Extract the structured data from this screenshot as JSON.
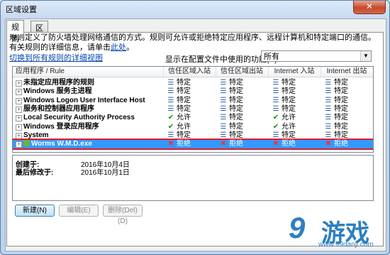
{
  "window": {
    "title": "区域设置",
    "close_label": "✕"
  },
  "tabs": [
    {
      "label": "规则"
    },
    {
      "label": "区域"
    }
  ],
  "description": {
    "text": "规则定义了防火墙处理网络通信的方式。规则可允许或拒绝特定应用程序、远程计算机和特定端口的通信。 有关规则的详细信息，请单击",
    "link": "此处",
    "end": "。"
  },
  "switch_link": "切换到所有规则的详细视图",
  "show_label": "显示在配置文件中使用的功能(P):",
  "show_select": {
    "value": "所有"
  },
  "columns": {
    "rule": "应用程序 / Rule",
    "trusted_in": "信任区域入站",
    "trusted_out": "信任区域出站",
    "internet_in": "Internet 入站",
    "internet_out": "Internet 出站"
  },
  "rows": [
    {
      "name": "未指定应用程序的规则",
      "trusted_in": "特定",
      "trusted_out": "特定",
      "internet_in": "特定",
      "internet_out": "特定",
      "icons": [
        "spec",
        "spec",
        "spec",
        "spec"
      ]
    },
    {
      "name": "Windows 服务主进程",
      "trusted_in": "特定",
      "trusted_out": "特定",
      "internet_in": "特定",
      "internet_out": "特定",
      "icons": [
        "spec",
        "spec",
        "spec",
        "spec"
      ]
    },
    {
      "name": "Windows Logon User Interface Host",
      "trusted_in": "特定",
      "trusted_out": "特定",
      "internet_in": "特定",
      "internet_out": "特定",
      "icons": [
        "spec",
        "spec",
        "spec",
        "spec"
      ]
    },
    {
      "name": "服务和控制器应用程序",
      "trusted_in": "特定",
      "trusted_out": "特定",
      "internet_in": "特定",
      "internet_out": "特定",
      "icons": [
        "spec",
        "spec",
        "spec",
        "spec"
      ]
    },
    {
      "name": "Local Security Authority Process",
      "trusted_in": "允许",
      "trusted_out": "特定",
      "internet_in": "允许",
      "internet_out": "特定",
      "icons": [
        "allow",
        "spec",
        "allow",
        "spec"
      ]
    },
    {
      "name": "Windows 登录应用程序",
      "trusted_in": "允许",
      "trusted_out": "特定",
      "internet_in": "允许",
      "internet_out": "特定",
      "icons": [
        "allow",
        "spec",
        "allow",
        "spec"
      ]
    },
    {
      "name": "System",
      "trusted_in": "特定",
      "trusted_out": "特定",
      "internet_in": "特定",
      "internet_out": "特定",
      "icons": [
        "spec",
        "spec",
        "spec",
        "spec"
      ]
    },
    {
      "name": "Worms W.M.D.exe",
      "trusted_in": "拒绝",
      "trusted_out": "拒绝",
      "internet_in": "拒绝",
      "internet_out": "拒绝",
      "icons": [
        "deny",
        "deny",
        "deny",
        "deny"
      ],
      "selected": true
    }
  ],
  "icon_glyphs": {
    "spec": "☰",
    "allow": "✔",
    "deny": "✖"
  },
  "details": {
    "created_label": "创建于:",
    "created_value": "2016年10月4日",
    "modified_label": "最后修改于:",
    "modified_value": "2016年10月1日"
  },
  "buttons": {
    "new": "新建(N)",
    "edit": "编辑(E)",
    "delete": "删除(Del)(D)"
  },
  "watermark": {
    "nine": "9",
    "brand": "游戏",
    "site": "www.99danji.com"
  },
  "colors": {
    "selected_row": "#3399ff",
    "highlight_border": "#e01c2a",
    "link": "#0645ad"
  }
}
